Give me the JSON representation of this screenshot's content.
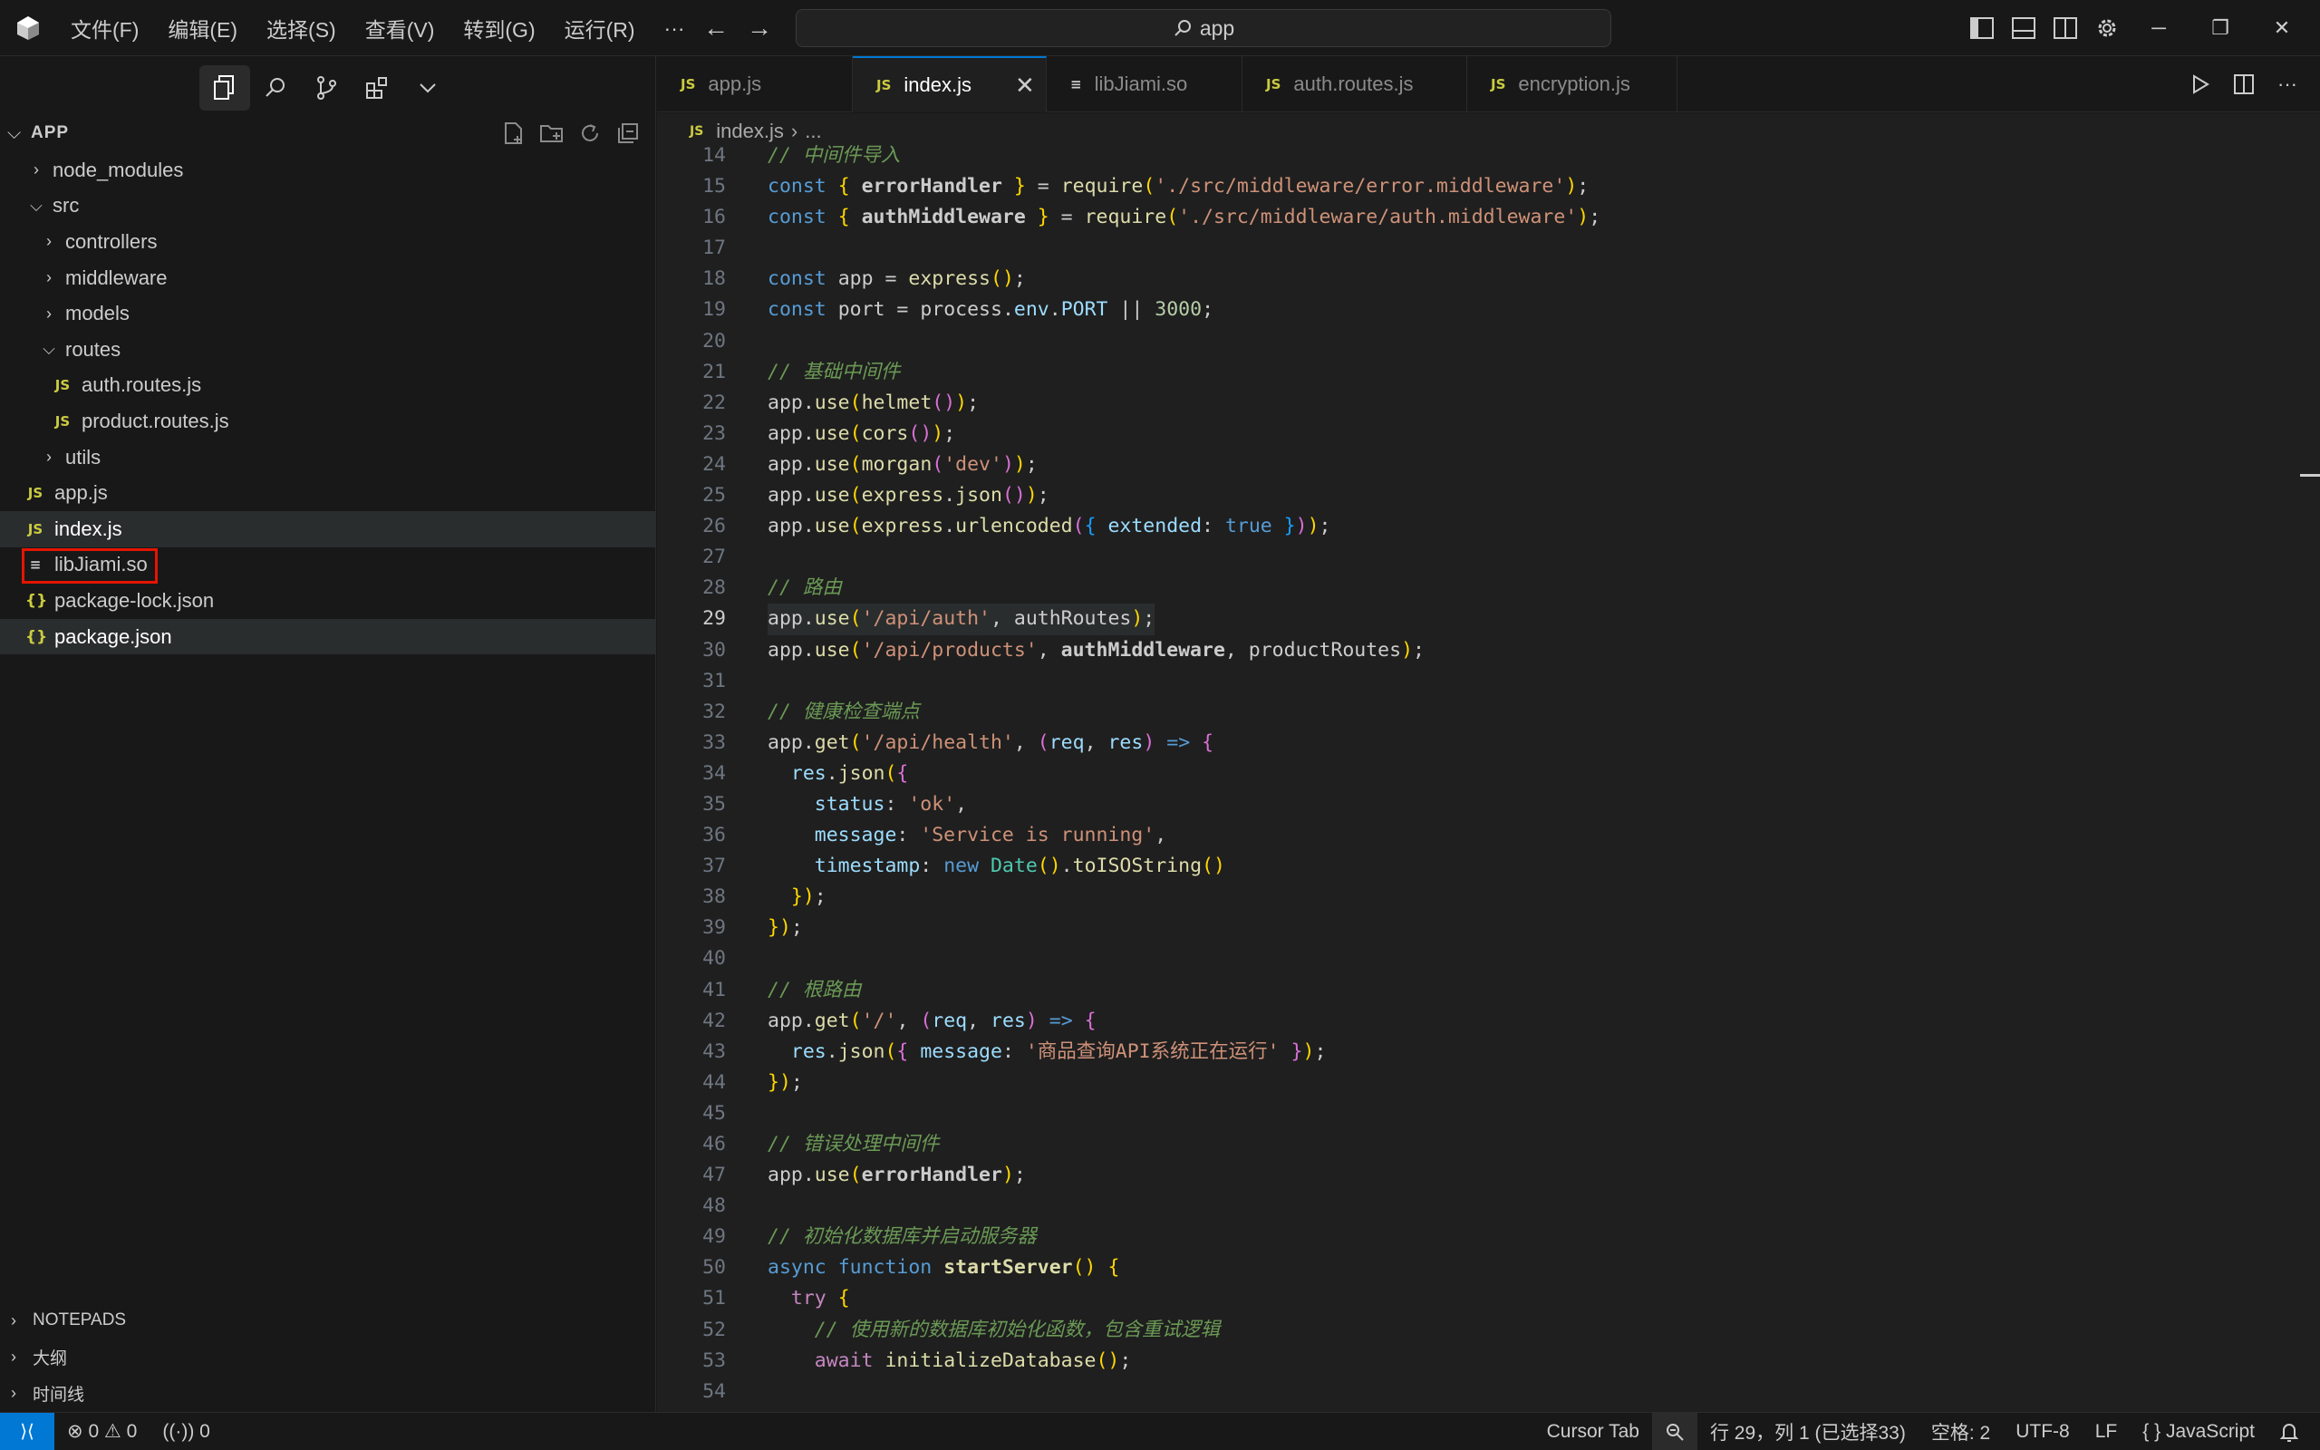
{
  "titlebar": {
    "menu": [
      "文件(F)",
      "编辑(E)",
      "选择(S)",
      "查看(V)",
      "转到(G)",
      "运行(R)"
    ],
    "more": "···",
    "search_text": "app"
  },
  "sidebar": {
    "explorer_title": "APP",
    "tree": [
      {
        "label": "node_modules",
        "type": "folder",
        "expanded": false,
        "depth": 0
      },
      {
        "label": "src",
        "type": "folder",
        "expanded": true,
        "depth": 0
      },
      {
        "label": "controllers",
        "type": "folder",
        "expanded": false,
        "depth": 1
      },
      {
        "label": "middleware",
        "type": "folder",
        "expanded": false,
        "depth": 1
      },
      {
        "label": "models",
        "type": "folder",
        "expanded": false,
        "depth": 1
      },
      {
        "label": "routes",
        "type": "folder",
        "expanded": true,
        "depth": 1
      },
      {
        "label": "auth.routes.js",
        "type": "js",
        "depth": 2
      },
      {
        "label": "product.routes.js",
        "type": "js",
        "depth": 2
      },
      {
        "label": "utils",
        "type": "folder",
        "expanded": false,
        "depth": 1
      },
      {
        "label": "app.js",
        "type": "js",
        "depth": 0
      },
      {
        "label": "index.js",
        "type": "js",
        "depth": 0,
        "selected": true
      },
      {
        "label": "libJiami.so",
        "type": "doc",
        "depth": 0,
        "highlighted": true
      },
      {
        "label": "package-lock.json",
        "type": "json",
        "depth": 0
      },
      {
        "label": "package.json",
        "type": "json",
        "depth": 0,
        "selected": true
      }
    ],
    "sections": [
      "NOTEPADS",
      "大纲",
      "时间线"
    ]
  },
  "tabs": [
    {
      "label": "app.js",
      "icon": "JS",
      "active": false
    },
    {
      "label": "index.js",
      "icon": "JS",
      "active": true
    },
    {
      "label": "libJiami.so",
      "icon": "doc",
      "active": false
    },
    {
      "label": "auth.routes.js",
      "icon": "JS",
      "active": false
    },
    {
      "label": "encryption.js",
      "icon": "JS",
      "active": false
    }
  ],
  "breadcrumb": {
    "file": "index.js",
    "sep": "›",
    "rest": "..."
  },
  "editor": {
    "current_line": 29,
    "lines": [
      {
        "n": "14",
        "code": "// 中间件导入"
      },
      {
        "n": "15",
        "code": "const { errorHandler } = require('./src/middleware/error.middleware');"
      },
      {
        "n": "16",
        "code": "const { authMiddleware } = require('./src/middleware/auth.middleware');"
      },
      {
        "n": "17",
        "code": ""
      },
      {
        "n": "18",
        "code": "const app = express();"
      },
      {
        "n": "19",
        "code": "const port = process.env.PORT || 3000;"
      },
      {
        "n": "20",
        "code": ""
      },
      {
        "n": "21",
        "code": "// 基础中间件"
      },
      {
        "n": "22",
        "code": "app.use(helmet());"
      },
      {
        "n": "23",
        "code": "app.use(cors());"
      },
      {
        "n": "24",
        "code": "app.use(morgan('dev'));"
      },
      {
        "n": "25",
        "code": "app.use(express.json());"
      },
      {
        "n": "26",
        "code": "app.use(express.urlencoded({ extended: true }));"
      },
      {
        "n": "27",
        "code": ""
      },
      {
        "n": "28",
        "code": "// 路由"
      },
      {
        "n": "29",
        "code": "app.use('/api/auth', authRoutes);"
      },
      {
        "n": "30",
        "code": "app.use('/api/products', authMiddleware, productRoutes);"
      },
      {
        "n": "31",
        "code": ""
      },
      {
        "n": "32",
        "code": "// 健康检查端点"
      },
      {
        "n": "33",
        "code": "app.get('/api/health', (req, res) => {"
      },
      {
        "n": "34",
        "code": "  res.json({"
      },
      {
        "n": "35",
        "code": "    status: 'ok',"
      },
      {
        "n": "36",
        "code": "    message: 'Service is running',"
      },
      {
        "n": "37",
        "code": "    timestamp: new Date().toISOString()"
      },
      {
        "n": "38",
        "code": "  });"
      },
      {
        "n": "39",
        "code": "});"
      },
      {
        "n": "40",
        "code": ""
      },
      {
        "n": "41",
        "code": "// 根路由"
      },
      {
        "n": "42",
        "code": "app.get('/', (req, res) => {"
      },
      {
        "n": "43",
        "code": "  res.json({ message: '商品查询API系统正在运行' });"
      },
      {
        "n": "44",
        "code": "});"
      },
      {
        "n": "45",
        "code": ""
      },
      {
        "n": "46",
        "code": "// 错误处理中间件"
      },
      {
        "n": "47",
        "code": "app.use(errorHandler);"
      },
      {
        "n": "48",
        "code": ""
      },
      {
        "n": "49",
        "code": "// 初始化数据库并启动服务器"
      },
      {
        "n": "50",
        "code": "async function startServer() {"
      },
      {
        "n": "51",
        "code": "  try {"
      },
      {
        "n": "52",
        "code": "    // 使用新的数据库初始化函数，包含重试逻辑"
      },
      {
        "n": "53",
        "code": "    await initializeDatabase();"
      },
      {
        "n": "54",
        "code": ""
      }
    ]
  },
  "statusbar": {
    "errors": "0",
    "warnings": "0",
    "ports": "0",
    "cursor_tab": "Cursor Tab",
    "position": "行 29，列 1 (已选择33)",
    "spaces": "空格: 2",
    "encoding": "UTF-8",
    "eol": "LF",
    "language": "JavaScript"
  },
  "colors": {
    "accent": "#0078d4",
    "highlight_box": "#e51400",
    "js_icon": "#cbcb41"
  }
}
